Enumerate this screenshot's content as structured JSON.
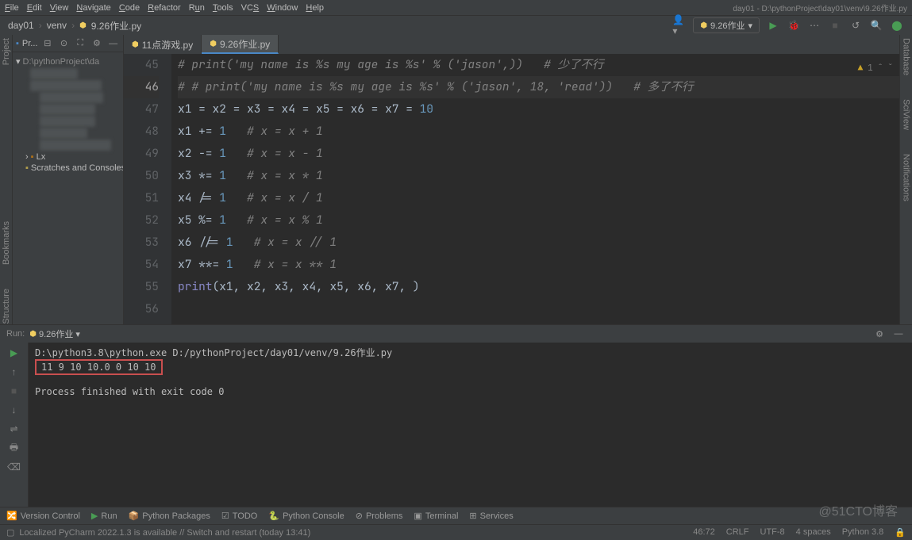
{
  "menu": {
    "file": "File",
    "edit": "Edit",
    "view": "View",
    "navigate": "Navigate",
    "code": "Code",
    "refactor": "Refactor",
    "run": "Run",
    "tools": "Tools",
    "vcs": "VCS",
    "window": "Window",
    "help": "Help"
  },
  "title_bar": "day01 - D:\\pythonProject\\day01\\venv\\9.26作业.py",
  "breadcrumbs": {
    "project": "day01",
    "venv": "venv",
    "file": "9.26作业.py"
  },
  "run_config": "9.26作业",
  "project_panel": {
    "title": "Pr...",
    "root": "D:\\pythonProject\\da",
    "libs": "Lx",
    "scratch": "Scratches and Consoles"
  },
  "tabs": [
    {
      "name": "11点游戏.py",
      "active": false
    },
    {
      "name": "9.26作业.py",
      "active": true
    }
  ],
  "inspections": {
    "warnings": "1",
    "count": "^"
  },
  "gutter_start": 45,
  "code_lines": [
    {
      "raw": "# print('my name is %s my age is %s' % ('jason',))   # 少了不行",
      "type": "comment"
    },
    {
      "raw": "# # print('my name is %s my age is %s' % ('jason', 18, 'read'))   # 多了不行",
      "type": "comment",
      "current": true
    },
    {
      "tokens": [
        [
          "var",
          "x1"
        ],
        [
          "op",
          " = "
        ],
        [
          "var",
          "x2"
        ],
        [
          "op",
          " = "
        ],
        [
          "var",
          "x3"
        ],
        [
          "op",
          " = "
        ],
        [
          "var",
          "x4"
        ],
        [
          "op",
          " = "
        ],
        [
          "var",
          "x5"
        ],
        [
          "op",
          " = "
        ],
        [
          "var",
          "x6"
        ],
        [
          "op",
          " = "
        ],
        [
          "var",
          "x7"
        ],
        [
          "op",
          " = "
        ],
        [
          "num",
          "10"
        ]
      ]
    },
    {
      "tokens": [
        [
          "var",
          "x1"
        ],
        [
          "op",
          " += "
        ],
        [
          "num",
          "1"
        ],
        [
          "op",
          "   "
        ],
        [
          "comment",
          "# x = x + 1"
        ]
      ]
    },
    {
      "tokens": [
        [
          "var",
          "x2"
        ],
        [
          "op",
          " -= "
        ],
        [
          "num",
          "1"
        ],
        [
          "op",
          "   "
        ],
        [
          "comment",
          "# x = x - 1"
        ]
      ]
    },
    {
      "tokens": [
        [
          "var",
          "x3"
        ],
        [
          "op",
          " *= "
        ],
        [
          "num",
          "1"
        ],
        [
          "op",
          "   "
        ],
        [
          "comment",
          "# x = x * 1"
        ]
      ]
    },
    {
      "tokens": [
        [
          "var",
          "x4"
        ],
        [
          "op",
          " /= "
        ],
        [
          "num",
          "1"
        ],
        [
          "op",
          "   "
        ],
        [
          "comment",
          "# x = x / 1"
        ]
      ]
    },
    {
      "tokens": [
        [
          "var",
          "x5"
        ],
        [
          "op",
          " %= "
        ],
        [
          "num",
          "1"
        ],
        [
          "op",
          "   "
        ],
        [
          "comment",
          "# x = x % 1"
        ]
      ]
    },
    {
      "tokens": [
        [
          "var",
          "x6"
        ],
        [
          "op",
          " //= "
        ],
        [
          "num",
          "1"
        ],
        [
          "op",
          "   "
        ],
        [
          "comment",
          "# x = x // 1"
        ]
      ]
    },
    {
      "tokens": [
        [
          "var",
          "x7"
        ],
        [
          "op",
          " **= "
        ],
        [
          "num",
          "1"
        ],
        [
          "op",
          "   "
        ],
        [
          "comment",
          "# x = x ** 1"
        ]
      ]
    },
    {
      "tokens": [
        [
          "fn",
          "print"
        ],
        [
          "op",
          "("
        ],
        [
          "var",
          "x1"
        ],
        [
          "op",
          ", "
        ],
        [
          "var",
          "x2"
        ],
        [
          "op",
          ", "
        ],
        [
          "var",
          "x3"
        ],
        [
          "op",
          ", "
        ],
        [
          "var",
          "x4"
        ],
        [
          "op",
          ", "
        ],
        [
          "var",
          "x5"
        ],
        [
          "op",
          ", "
        ],
        [
          "var",
          "x6"
        ],
        [
          "op",
          ", "
        ],
        [
          "var",
          "x7"
        ],
        [
          "op",
          ", )"
        ]
      ]
    },
    {
      "tokens": []
    }
  ],
  "run_panel": {
    "title": "Run:",
    "name": "9.26作业",
    "cmd": "D:\\python3.8\\python.exe D:/pythonProject/day01/venv/9.26作业.py",
    "output": "11 9 10 10.0 0 10 10",
    "exit": "Process finished with exit code 0"
  },
  "bottom_tabs": {
    "vc": "Version Control",
    "run": "Run",
    "pypkg": "Python Packages",
    "todo": "TODO",
    "pycon": "Python Console",
    "problems": "Problems",
    "terminal": "Terminal",
    "services": "Services"
  },
  "status": {
    "msg": "Localized PyCharm 2022.1.3 is available // Switch and restart (today 13:41)",
    "pos": "46:72",
    "sep": "CRLF",
    "enc": "UTF-8",
    "indent": "4 spaces",
    "interp": "Python 3.8"
  },
  "left_tools": {
    "project": "Project",
    "bookmarks": "Bookmarks",
    "structure": "Structure"
  },
  "right_tools": {
    "database": "Database",
    "sciview": "SciView",
    "notifications": "Notifications"
  },
  "watermark": "@51CTO博客"
}
